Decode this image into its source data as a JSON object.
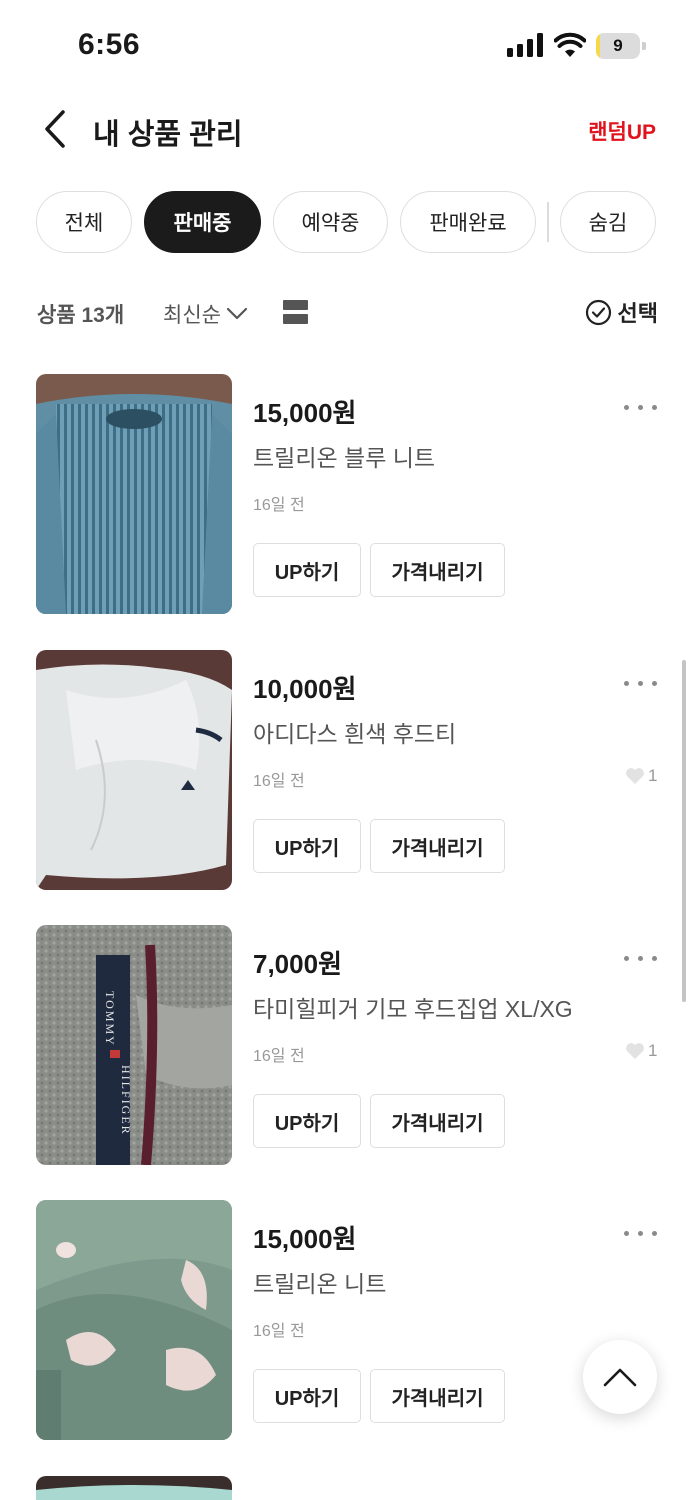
{
  "status_bar": {
    "time": "6:56",
    "battery": "9"
  },
  "header": {
    "title": "내 상품 관리",
    "random_up": "랜덤UP"
  },
  "filters": [
    "전체",
    "판매중",
    "예약중",
    "판매완료",
    "숨김"
  ],
  "active_filter": "판매중",
  "toolbar": {
    "count": "상품 13개",
    "sort": "최신순",
    "select": "선택"
  },
  "buttons": {
    "up": "UP하기",
    "price_down": "가격내리기"
  },
  "items": [
    {
      "price": "15,000원",
      "name": "트릴리온 블루 니트",
      "time": "16일 전",
      "likes": ""
    },
    {
      "price": "10,000원",
      "name": "아디다스 흰색 후드티",
      "time": "16일 전",
      "likes": "1"
    },
    {
      "price": "7,000원",
      "name": "타미힐피거 기모 후드집업 XL/XG",
      "time": "16일 전",
      "likes": "1"
    },
    {
      "price": "15,000원",
      "name": "트릴리온 니트",
      "time": "16일 전",
      "likes": ""
    }
  ],
  "thumb_labels": {
    "tommy": "TOMMY",
    "hilfiger": "HILFIGER"
  },
  "colors": {
    "accent": "#e0121c",
    "active_chip": "#1b1b1b",
    "battery": "#f7d84a"
  },
  "icons": [
    "back-icon",
    "signal-icon",
    "wifi-icon",
    "battery-icon",
    "chevron-down-icon",
    "list-view-icon",
    "check-circle-icon",
    "more-icon",
    "heart-icon",
    "chevron-up-icon"
  ]
}
